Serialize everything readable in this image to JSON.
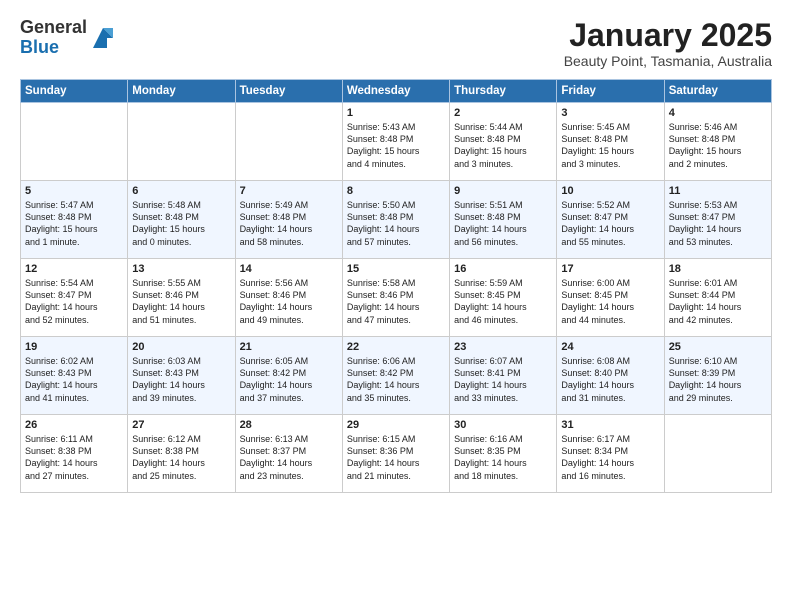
{
  "logo": {
    "general": "General",
    "blue": "Blue"
  },
  "title": "January 2025",
  "subtitle": "Beauty Point, Tasmania, Australia",
  "days_of_week": [
    "Sunday",
    "Monday",
    "Tuesday",
    "Wednesday",
    "Thursday",
    "Friday",
    "Saturday"
  ],
  "weeks": [
    [
      {
        "day": "",
        "info": ""
      },
      {
        "day": "",
        "info": ""
      },
      {
        "day": "",
        "info": ""
      },
      {
        "day": "1",
        "info": "Sunrise: 5:43 AM\nSunset: 8:48 PM\nDaylight: 15 hours\nand 4 minutes."
      },
      {
        "day": "2",
        "info": "Sunrise: 5:44 AM\nSunset: 8:48 PM\nDaylight: 15 hours\nand 3 minutes."
      },
      {
        "day": "3",
        "info": "Sunrise: 5:45 AM\nSunset: 8:48 PM\nDaylight: 15 hours\nand 3 minutes."
      },
      {
        "day": "4",
        "info": "Sunrise: 5:46 AM\nSunset: 8:48 PM\nDaylight: 15 hours\nand 2 minutes."
      }
    ],
    [
      {
        "day": "5",
        "info": "Sunrise: 5:47 AM\nSunset: 8:48 PM\nDaylight: 15 hours\nand 1 minute."
      },
      {
        "day": "6",
        "info": "Sunrise: 5:48 AM\nSunset: 8:48 PM\nDaylight: 15 hours\nand 0 minutes."
      },
      {
        "day": "7",
        "info": "Sunrise: 5:49 AM\nSunset: 8:48 PM\nDaylight: 14 hours\nand 58 minutes."
      },
      {
        "day": "8",
        "info": "Sunrise: 5:50 AM\nSunset: 8:48 PM\nDaylight: 14 hours\nand 57 minutes."
      },
      {
        "day": "9",
        "info": "Sunrise: 5:51 AM\nSunset: 8:48 PM\nDaylight: 14 hours\nand 56 minutes."
      },
      {
        "day": "10",
        "info": "Sunrise: 5:52 AM\nSunset: 8:47 PM\nDaylight: 14 hours\nand 55 minutes."
      },
      {
        "day": "11",
        "info": "Sunrise: 5:53 AM\nSunset: 8:47 PM\nDaylight: 14 hours\nand 53 minutes."
      }
    ],
    [
      {
        "day": "12",
        "info": "Sunrise: 5:54 AM\nSunset: 8:47 PM\nDaylight: 14 hours\nand 52 minutes."
      },
      {
        "day": "13",
        "info": "Sunrise: 5:55 AM\nSunset: 8:46 PM\nDaylight: 14 hours\nand 51 minutes."
      },
      {
        "day": "14",
        "info": "Sunrise: 5:56 AM\nSunset: 8:46 PM\nDaylight: 14 hours\nand 49 minutes."
      },
      {
        "day": "15",
        "info": "Sunrise: 5:58 AM\nSunset: 8:46 PM\nDaylight: 14 hours\nand 47 minutes."
      },
      {
        "day": "16",
        "info": "Sunrise: 5:59 AM\nSunset: 8:45 PM\nDaylight: 14 hours\nand 46 minutes."
      },
      {
        "day": "17",
        "info": "Sunrise: 6:00 AM\nSunset: 8:45 PM\nDaylight: 14 hours\nand 44 minutes."
      },
      {
        "day": "18",
        "info": "Sunrise: 6:01 AM\nSunset: 8:44 PM\nDaylight: 14 hours\nand 42 minutes."
      }
    ],
    [
      {
        "day": "19",
        "info": "Sunrise: 6:02 AM\nSunset: 8:43 PM\nDaylight: 14 hours\nand 41 minutes."
      },
      {
        "day": "20",
        "info": "Sunrise: 6:03 AM\nSunset: 8:43 PM\nDaylight: 14 hours\nand 39 minutes."
      },
      {
        "day": "21",
        "info": "Sunrise: 6:05 AM\nSunset: 8:42 PM\nDaylight: 14 hours\nand 37 minutes."
      },
      {
        "day": "22",
        "info": "Sunrise: 6:06 AM\nSunset: 8:42 PM\nDaylight: 14 hours\nand 35 minutes."
      },
      {
        "day": "23",
        "info": "Sunrise: 6:07 AM\nSunset: 8:41 PM\nDaylight: 14 hours\nand 33 minutes."
      },
      {
        "day": "24",
        "info": "Sunrise: 6:08 AM\nSunset: 8:40 PM\nDaylight: 14 hours\nand 31 minutes."
      },
      {
        "day": "25",
        "info": "Sunrise: 6:10 AM\nSunset: 8:39 PM\nDaylight: 14 hours\nand 29 minutes."
      }
    ],
    [
      {
        "day": "26",
        "info": "Sunrise: 6:11 AM\nSunset: 8:38 PM\nDaylight: 14 hours\nand 27 minutes."
      },
      {
        "day": "27",
        "info": "Sunrise: 6:12 AM\nSunset: 8:38 PM\nDaylight: 14 hours\nand 25 minutes."
      },
      {
        "day": "28",
        "info": "Sunrise: 6:13 AM\nSunset: 8:37 PM\nDaylight: 14 hours\nand 23 minutes."
      },
      {
        "day": "29",
        "info": "Sunrise: 6:15 AM\nSunset: 8:36 PM\nDaylight: 14 hours\nand 21 minutes."
      },
      {
        "day": "30",
        "info": "Sunrise: 6:16 AM\nSunset: 8:35 PM\nDaylight: 14 hours\nand 18 minutes."
      },
      {
        "day": "31",
        "info": "Sunrise: 6:17 AM\nSunset: 8:34 PM\nDaylight: 14 hours\nand 16 minutes."
      },
      {
        "day": "",
        "info": ""
      }
    ]
  ]
}
